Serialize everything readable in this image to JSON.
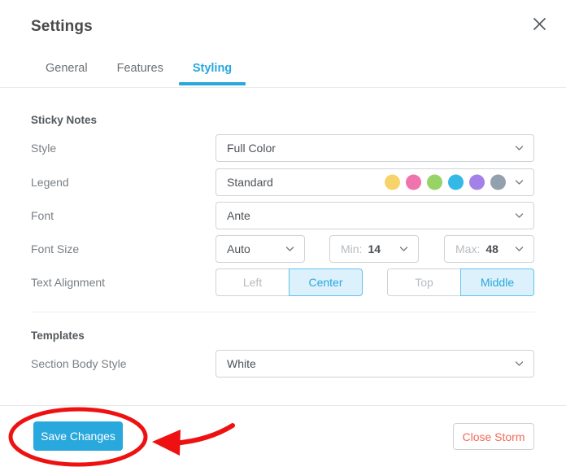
{
  "window": {
    "title": "Settings",
    "close_icon": "close-icon"
  },
  "tabs": [
    {
      "label": "General",
      "active": false
    },
    {
      "label": "Features",
      "active": false
    },
    {
      "label": "Styling",
      "active": true
    }
  ],
  "sections": {
    "sticky_notes": {
      "title": "Sticky Notes",
      "rows": {
        "style": {
          "label": "Style",
          "value": "Full Color"
        },
        "legend": {
          "label": "Legend",
          "value": "Standard",
          "swatch_colors": [
            "#f7d46a",
            "#ef73ac",
            "#97d365",
            "#34b9e6",
            "#a481e8",
            "#93a0ad"
          ]
        },
        "font": {
          "label": "Font",
          "value": "Ante"
        },
        "font_size": {
          "label": "Font Size",
          "mode": "Auto",
          "min_prefix": "Min:",
          "min_value": "14",
          "max_prefix": "Max:",
          "max_value": "48"
        },
        "text_alignment": {
          "label": "Text Alignment",
          "horizontal": [
            {
              "label": "Left",
              "active": false
            },
            {
              "label": "Center",
              "active": true
            }
          ],
          "vertical": [
            {
              "label": "Top",
              "active": false
            },
            {
              "label": "Middle",
              "active": true
            }
          ]
        }
      }
    },
    "templates": {
      "title": "Templates",
      "rows": {
        "section_body_style": {
          "label": "Section Body Style",
          "value": "White"
        }
      }
    }
  },
  "footer": {
    "save_label": "Save Changes",
    "close_storm_label": "Close Storm"
  },
  "annotations": {
    "highlight_color": "#ee1111",
    "ellipse_name": "save-button-highlight-ellipse",
    "arrow_name": "pointer-arrow"
  },
  "colors": {
    "accent": "#29a8dd",
    "accent_soft": "#dcf1fb",
    "danger": "#f36a5a",
    "annotation": "#ee1111"
  }
}
